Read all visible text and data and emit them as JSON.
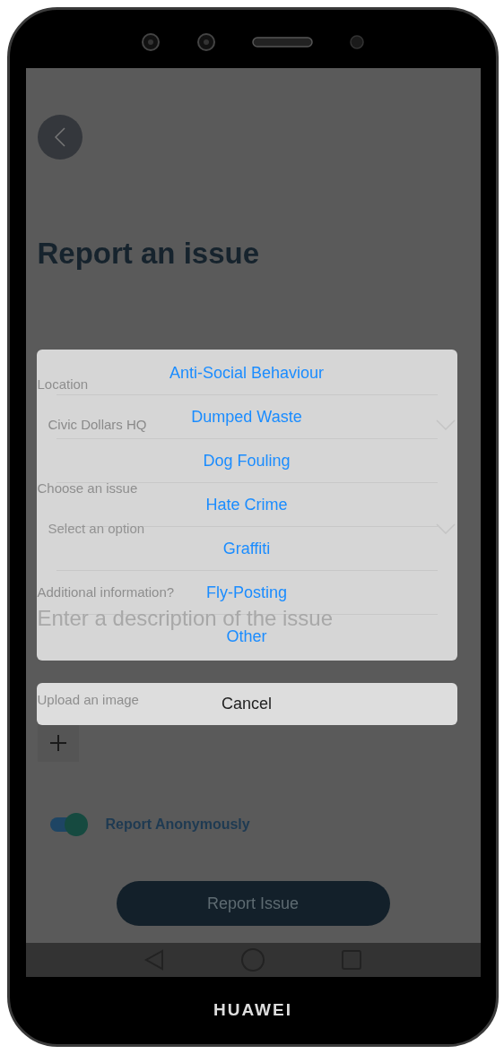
{
  "device": {
    "brand": "HUAWEI"
  },
  "screen": {
    "title": "Report an issue",
    "fields": [
      {
        "kind": "select",
        "label": "Location",
        "value": "Civic Dollars HQ"
      },
      {
        "kind": "select",
        "label": "Choose an issue",
        "placeholder": "Select an option"
      },
      {
        "kind": "text",
        "label": "Additional information?",
        "placeholder": "Enter a description of the issue"
      },
      {
        "kind": "upload",
        "label": "Upload an image"
      }
    ],
    "toggle": {
      "label": "Report Anonymously",
      "on": true
    },
    "submit_button": "Report Issue"
  },
  "action_sheet": {
    "options": [
      "Anti-Social Behaviour",
      "Dumped Waste",
      "Dog Fouling",
      "Hate Crime",
      "Graffiti",
      "Fly-Posting",
      "Other"
    ],
    "cancel": "Cancel"
  }
}
